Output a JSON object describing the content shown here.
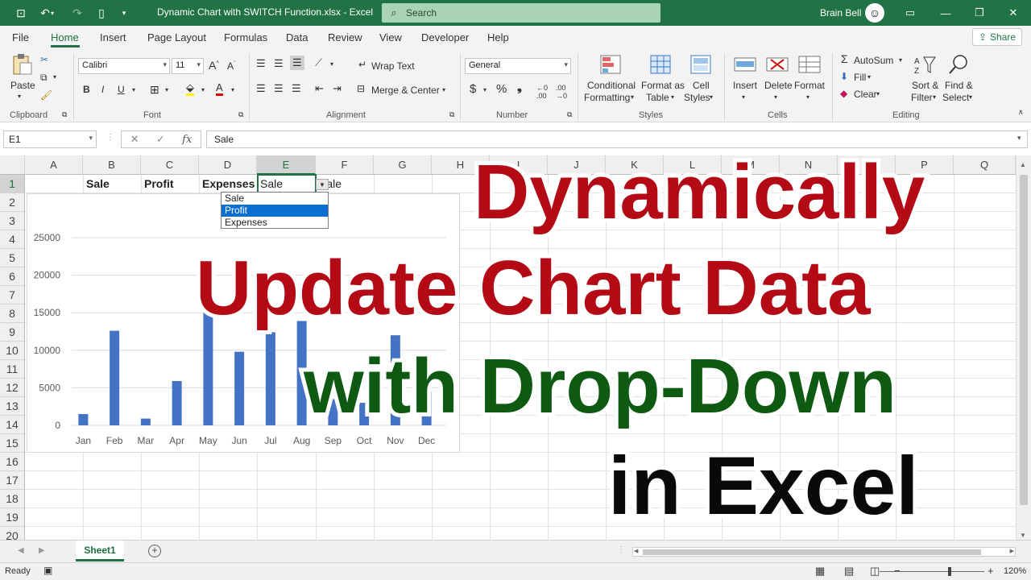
{
  "titlebar": {
    "title": "Dynamic Chart with SWITCH Function.xlsx  -  Excel",
    "search_placeholder": "Search",
    "user": "Brain Bell"
  },
  "tabs": [
    "File",
    "Home",
    "Insert",
    "Page Layout",
    "Formulas",
    "Data",
    "Review",
    "View",
    "Developer",
    "Help"
  ],
  "active_tab": "Home",
  "share_label": "Share",
  "ribbon": {
    "clipboard": {
      "paste": "Paste",
      "label": "Clipboard"
    },
    "font": {
      "name": "Calibri",
      "size": "11",
      "label": "Font"
    },
    "alignment": {
      "wrap": "Wrap Text",
      "merge": "Merge & Center",
      "label": "Alignment"
    },
    "number": {
      "format": "General",
      "label": "Number"
    },
    "styles": {
      "cond": "Conditional",
      "cond2": "Formatting",
      "fat": "Format as",
      "fat2": "Table",
      "cell": "Cell",
      "cell2": "Styles",
      "label": "Styles"
    },
    "cells": {
      "insert": "Insert",
      "delete": "Delete",
      "format": "Format",
      "label": "Cells"
    },
    "editing": {
      "autosum": "AutoSum",
      "fill": "Fill",
      "clear": "Clear",
      "sort": "Sort &",
      "sort2": "Filter",
      "find": "Find &",
      "find2": "Select",
      "label": "Editing"
    }
  },
  "formula_bar": {
    "cell_ref": "E1",
    "formula": "Sale"
  },
  "columns": [
    "A",
    "B",
    "C",
    "D",
    "E",
    "F",
    "G",
    "H",
    "I",
    "J",
    "K",
    "L",
    "M",
    "N",
    "O",
    "P",
    "Q"
  ],
  "rows": [
    "1",
    "2",
    "3",
    "4",
    "5",
    "6",
    "7",
    "8",
    "9",
    "10",
    "11",
    "12",
    "13",
    "14",
    "15",
    "16",
    "17",
    "18",
    "19",
    "20"
  ],
  "cells": {
    "B1": "Sale",
    "C1": "Profit",
    "D1": "Expenses",
    "E1": "Sale",
    "F1": "Sale"
  },
  "dropdown": {
    "options": [
      "Sale",
      "Profit",
      "Expenses"
    ],
    "highlighted": "Profit"
  },
  "chart_data": {
    "type": "bar",
    "categories": [
      "Jan",
      "Feb",
      "Mar",
      "Apr",
      "May",
      "Jun",
      "Jul",
      "Aug",
      "Sep",
      "Oct",
      "Nov",
      "Dec"
    ],
    "values": [
      1500,
      12600,
      900,
      5900,
      19500,
      9800,
      12400,
      13900,
      3500,
      3000,
      12000,
      4500
    ],
    "ylim": [
      0,
      25000
    ],
    "yticks": [
      "25000",
      "20000",
      "15000",
      "10000",
      "5000",
      "0"
    ],
    "ytick_values": [
      25000,
      20000,
      15000,
      10000,
      5000,
      0
    ],
    "title": "",
    "xlabel": "",
    "ylabel": "",
    "grid": true,
    "color": "#4472c4"
  },
  "overlay_title": {
    "line1": "Dynamically",
    "line2": "Update Chart Data",
    "line3": "with Drop-Down",
    "line4": "in Excel",
    "color_red": "#b30a16",
    "color_green": "#0e5a12",
    "color_black": "#0a0a0a"
  },
  "sheet_tab": "Sheet1",
  "status": {
    "ready": "Ready",
    "zoom": "120%"
  }
}
